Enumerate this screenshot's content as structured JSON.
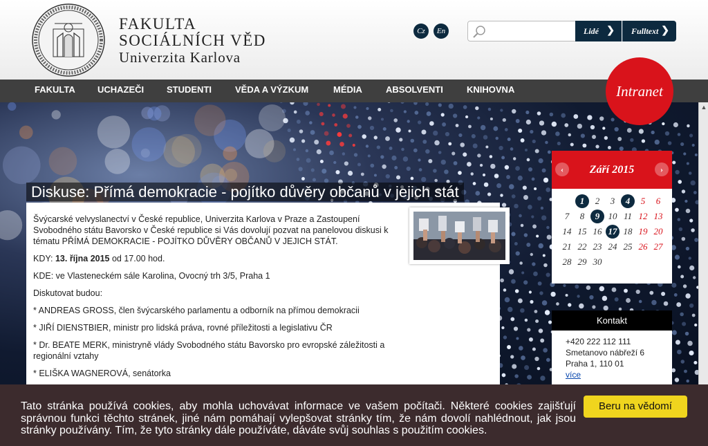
{
  "header": {
    "title_line1": "FAKULTA",
    "title_line2": "SOCIÁLNÍCH VĚD",
    "title_line3": "Univerzita Karlova",
    "lang_cz": "Cz",
    "lang_en": "En",
    "search": {
      "placeholder": "",
      "btn_people": "Lidé",
      "btn_fulltext": "Fulltext"
    }
  },
  "nav": {
    "items": [
      "FAKULTA",
      "UCHAZEČI",
      "STUDENTI",
      "VĚDA A VÝZKUM",
      "MÉDIA",
      "ABSOLVENTI",
      "KNIHOVNA"
    ],
    "intranet": "Intranet"
  },
  "article": {
    "headline": "Diskuse: Přímá demokracie - pojítko důvěry občanů v jejich stát",
    "intro": "Švýcarské velvyslanectví v České republice, Univerzita Karlova v Praze a Zastoupení Svobodného státu Bavorsko v České republice si Vás dovolují pozvat na panelovou diskusi k tématu PŘÍMÁ DEMOKRACIE - POJÍTKO DŮVĚRY OBČANŮ V JEJICH STÁT.",
    "when_label": "KDY: ",
    "when_date": "13. října 2015",
    "when_time": " od 17.00 hod.",
    "where": "KDE: ve Vlasteneckém sále Karolina, Ovocný trh 3/5, Praha 1",
    "speakers_label": "Diskutovat budou:",
    "speakers": [
      "* ANDREAS GROSS, člen švýcarského parlamentu a odborník na přímou demokracii",
      "* JIŘÍ DIENSTBIER, ministr pro lidská práva, rovné příležitosti a legislativu ČR",
      "* Dr. BEATE MERK, ministryně vlády Svobodného státu Bavorsko pro evropské záležitosti a regionální vztahy",
      "* ELIŠKA WAGNEROVÁ, senátorka"
    ]
  },
  "calendar": {
    "month": "Září 2015",
    "prev": "‹",
    "next": "›",
    "days": [
      {
        "n": "1",
        "type": "ev"
      },
      {
        "n": "2",
        "type": ""
      },
      {
        "n": "3",
        "type": ""
      },
      {
        "n": "4",
        "type": "ev"
      },
      {
        "n": "5",
        "type": "we"
      },
      {
        "n": "6",
        "type": "we"
      },
      {
        "n": "7",
        "type": ""
      },
      {
        "n": "8",
        "type": ""
      },
      {
        "n": "9",
        "type": "ev"
      },
      {
        "n": "10",
        "type": ""
      },
      {
        "n": "11",
        "type": ""
      },
      {
        "n": "12",
        "type": "we"
      },
      {
        "n": "13",
        "type": "we"
      },
      {
        "n": "14",
        "type": ""
      },
      {
        "n": "15",
        "type": ""
      },
      {
        "n": "16",
        "type": ""
      },
      {
        "n": "17",
        "type": "ev"
      },
      {
        "n": "18",
        "type": ""
      },
      {
        "n": "19",
        "type": "we"
      },
      {
        "n": "20",
        "type": "we"
      },
      {
        "n": "21",
        "type": ""
      },
      {
        "n": "22",
        "type": ""
      },
      {
        "n": "23",
        "type": ""
      },
      {
        "n": "24",
        "type": ""
      },
      {
        "n": "25",
        "type": ""
      },
      {
        "n": "26",
        "type": "we"
      },
      {
        "n": "27",
        "type": "we"
      },
      {
        "n": "28",
        "type": ""
      },
      {
        "n": "29",
        "type": ""
      },
      {
        "n": "30",
        "type": ""
      }
    ]
  },
  "contact": {
    "title": "Kontakt",
    "phone": "+420 222 112 111",
    "street": "Smetanovo nábřeží 6",
    "city": "Praha 1, 110 01",
    "more": "více"
  },
  "cookie": {
    "text": "Tato stránka používá cookies, aby mohla uchovávat informace ve vašem počítači. Některé cookies zajišťují správnou funkci těchto stránek, jiné nám pomáhají vylepšovat stránky tím, že nám dovolí nahlédnout, jak jsou stránky používány. Tím, že tyto stránky dále používáte, dáváte svůj souhlas s použitím cookies.",
    "button": "Beru na vědomí"
  },
  "colors": {
    "navy": "#0d2a3f",
    "red": "#d9131b",
    "nav_bg": "#3f3f3f",
    "cookie_bg": "#3c2b2d",
    "cookie_btn": "#f0d51e"
  }
}
